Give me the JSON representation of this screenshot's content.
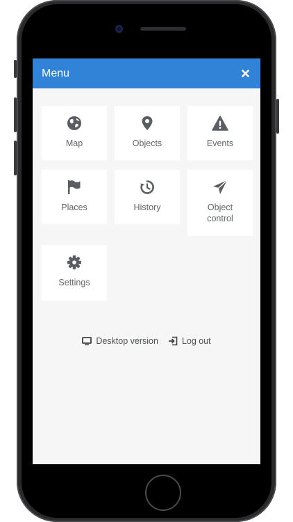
{
  "header": {
    "title": "Menu",
    "close_icon": "close-icon"
  },
  "tiles": [
    {
      "label": "Map",
      "icon": "globe-icon"
    },
    {
      "label": "Objects",
      "icon": "map-pin-icon"
    },
    {
      "label": "Events",
      "icon": "warning-icon"
    },
    {
      "label": "Places",
      "icon": "flag-icon"
    },
    {
      "label": "History",
      "icon": "history-icon"
    },
    {
      "label": "Object control",
      "icon": "send-icon"
    },
    {
      "label": "Settings",
      "icon": "gear-icon"
    }
  ],
  "footer": {
    "desktop_label": "Desktop version",
    "logout_label": "Log out"
  },
  "colors": {
    "header_bg": "#3083d6",
    "icon": "#5a5e62",
    "screen_bg": "#f6f6f6"
  }
}
